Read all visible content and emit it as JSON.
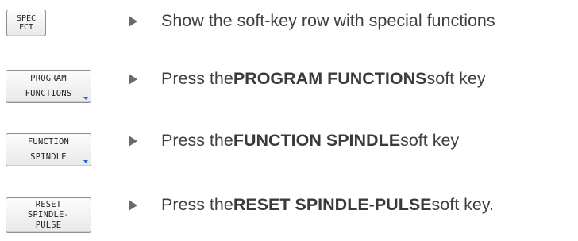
{
  "steps": [
    {
      "key_lines": [
        "SPEC",
        "FCT"
      ],
      "text_pre": "Show the soft-key row with special functions",
      "text_bold": "",
      "text_post": ""
    },
    {
      "key_lines": [
        "PROGRAM",
        "FUNCTIONS"
      ],
      "text_pre": "Press the ",
      "text_bold": "PROGRAM FUNCTIONS",
      "text_post": " soft key"
    },
    {
      "key_lines": [
        "FUNCTION",
        "SPINDLE"
      ],
      "text_pre": "Press the ",
      "text_bold": "FUNCTION SPINDLE",
      "text_post": " soft key"
    },
    {
      "key_lines": [
        "RESET",
        "SPINDLE-",
        "PULSE"
      ],
      "text_pre": "Press the ",
      "text_bold": "RESET SPINDLE-PULSE",
      "text_post": " soft key."
    }
  ],
  "colors": {
    "submenu_marker": "#1e6fd0",
    "arrow": "#6a6a6a",
    "text": "#404040"
  },
  "icons": {
    "arrow": "arrow-right-icon",
    "submenu_marker": "submenu-indicator-icon"
  }
}
